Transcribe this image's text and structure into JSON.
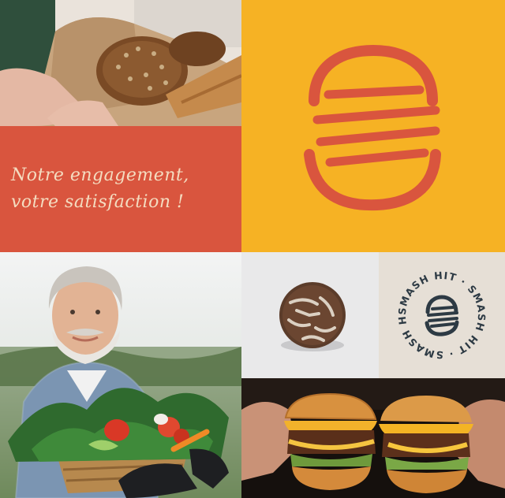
{
  "colors": {
    "terracotta": "#d9553e",
    "mustard": "#f6b224",
    "cream": "#e6dfd6",
    "light_grey": "#e9e9ea",
    "slogan_text": "#f4dcc0",
    "badge_ink": "#2d3a44"
  },
  "slogan": {
    "line1": "Notre engagement,",
    "line2": "votre satisfaction !"
  },
  "badge": {
    "ring_text": "SMASH HIT · SMASH HIT · SMASH HIT · "
  },
  "icons": {
    "logo": "stacked-burger-icon",
    "badge": "smash-hit-burger-icon"
  }
}
